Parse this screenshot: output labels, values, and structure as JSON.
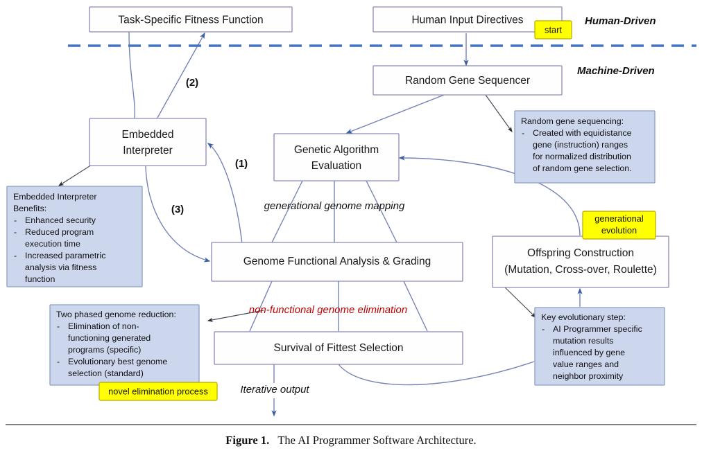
{
  "figure": {
    "caption_label": "Figure 1.",
    "caption_text": "The AI Programmer Software Architecture."
  },
  "lanes": {
    "human": "Human-Driven",
    "machine": "Machine-Driven"
  },
  "colors": {
    "node_stroke": "#8a8ab5",
    "note_fill": "#ccd6ec",
    "highlight_fill": "#ffff00",
    "divider": "#4472c4",
    "flow": "#7583b8",
    "accent_red": "#c00000"
  },
  "nodes": {
    "fitness": {
      "label": "Task-Specific Fitness Function"
    },
    "human_input": {
      "label": "Human Input Directives"
    },
    "sequencer": {
      "label": "Random Gene Sequencer"
    },
    "interpreter": {
      "line1": "Embedded",
      "line2": "Interpreter"
    },
    "ga_eval": {
      "line1": "Genetic Algorithm",
      "line2": "Evaluation"
    },
    "genome_analysis": {
      "label": "Genome Functional Analysis & Grading"
    },
    "offspring": {
      "line1": "Offspring Construction",
      "line2": "(Mutation, Cross-over, Roulette)"
    },
    "survival": {
      "label": "Survival of Fittest Selection"
    }
  },
  "highlights": {
    "start": {
      "label": "start"
    },
    "generational_evolution": {
      "line1": "generational",
      "line2": "evolution"
    },
    "novel_elimination": {
      "label": "novel elimination process"
    }
  },
  "notes": {
    "random_gene": {
      "title": "Random gene sequencing:",
      "bullets": [
        [
          "Created with equidistance",
          "gene (instruction) ranges",
          "for normalized distribution",
          "of random gene selection."
        ]
      ]
    },
    "interpreter_benefits": {
      "title_line1": "Embedded Interpreter",
      "title_line2": "Benefits:",
      "bullets": [
        [
          "Enhanced security"
        ],
        [
          "Reduced program",
          "execution time"
        ],
        [
          "Increased parametric",
          "analysis via fitness",
          "function"
        ]
      ]
    },
    "genome_reduction": {
      "title": "Two phased genome reduction:",
      "bullets": [
        [
          "Elimination of non-",
          "functioning generated",
          "programs (specific)"
        ],
        [
          "Evolutionary best genome",
          "selection (standard)"
        ]
      ]
    },
    "key_evolutionary": {
      "title": "Key evolutionary step:",
      "bullets": [
        [
          "AI Programmer specific",
          "mutation results",
          "influenced by gene",
          "value ranges and",
          "neighbor proximity"
        ]
      ]
    }
  },
  "edge_labels": {
    "one": "(1)",
    "two": "(2)",
    "three": "(3)",
    "generational_mapping": "generational genome mapping",
    "non_functional": "non-functional genome elimination",
    "iterative_output": "Iterative output"
  }
}
